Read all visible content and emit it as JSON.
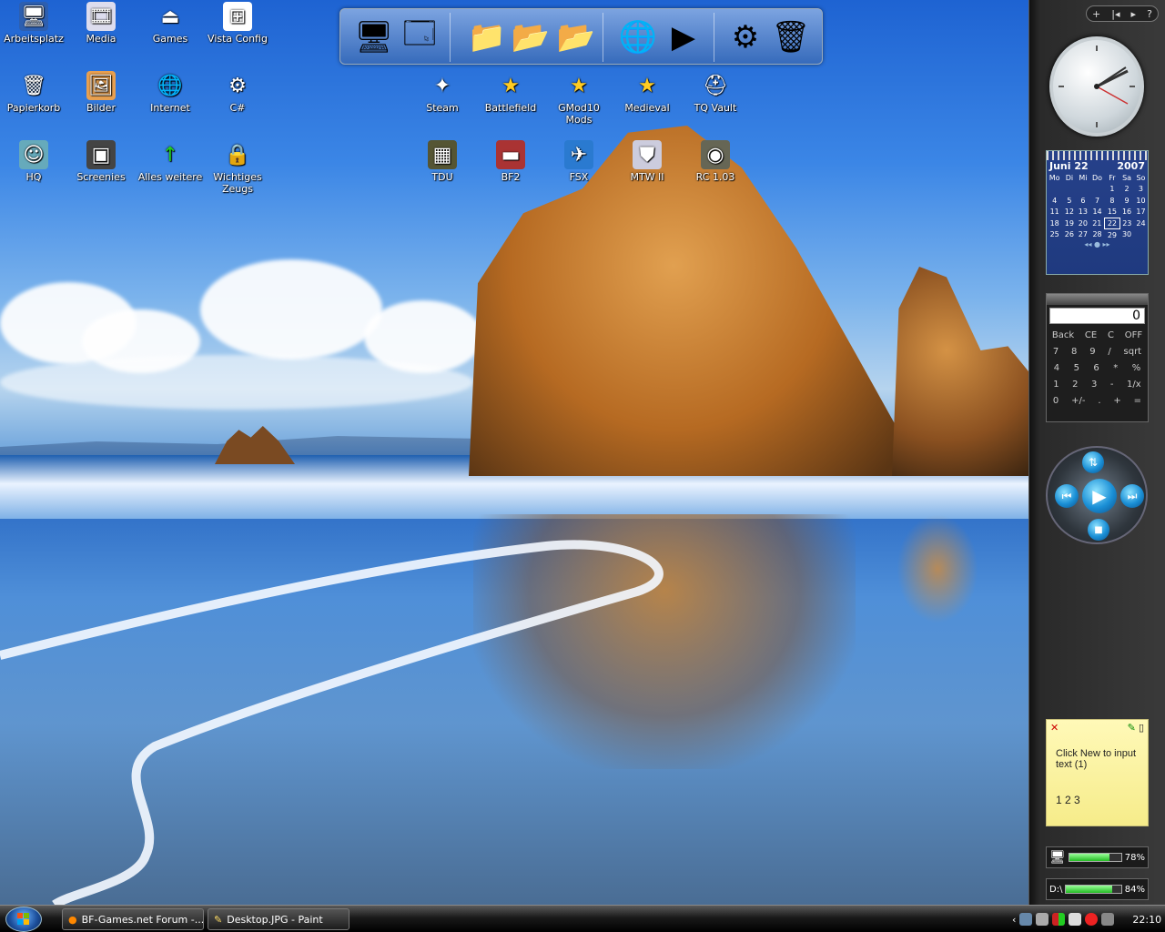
{
  "desktop_icons": [
    {
      "label": "Arbeitsplatz",
      "icon": "computer-icon",
      "glyph": "🖥",
      "bg": "#2d5fb0"
    },
    {
      "label": "Media",
      "icon": "media-file-icon",
      "glyph": "🎞",
      "bg": "#dde"
    },
    {
      "label": "Games",
      "icon": "eject-icon",
      "glyph": "⏏",
      "bg": "transparent"
    },
    {
      "label": "Vista Config",
      "icon": "windows-flag-icon",
      "glyph": "⊞",
      "bg": "#fff"
    },
    {
      "label": "Papierkorb",
      "icon": "recycle-bin-icon",
      "glyph": "🗑",
      "bg": "transparent"
    },
    {
      "label": "Bilder",
      "icon": "pictures-icon",
      "glyph": "🖼",
      "bg": "#e8a050"
    },
    {
      "label": "Internet",
      "icon": "globe-icon",
      "glyph": "🌐",
      "bg": "transparent"
    },
    {
      "label": "C#",
      "icon": "gear-icon",
      "glyph": "⚙",
      "bg": "transparent"
    },
    {
      "label": "HQ",
      "icon": "hq-game-icon",
      "glyph": "☺",
      "bg": "#6ab"
    },
    {
      "label": "Screenies",
      "icon": "monitor-icon",
      "glyph": "▣",
      "bg": "#444"
    },
    {
      "label": "Alles weitere",
      "icon": "green-arrow-icon",
      "glyph": "↑",
      "bg": "transparent"
    },
    {
      "label": "Wichtiges Zeugs",
      "icon": "lock-icon",
      "glyph": "🔒",
      "bg": "transparent"
    },
    {
      "label": "Steam",
      "icon": "steam-icon",
      "glyph": "✦",
      "bg": "transparent"
    },
    {
      "label": "Battlefield",
      "icon": "star-icon",
      "glyph": "★",
      "bg": "transparent"
    },
    {
      "label": "GMod10 Mods",
      "icon": "star-icon",
      "glyph": "★",
      "bg": "transparent"
    },
    {
      "label": "Medieval",
      "icon": "star-icon",
      "glyph": "★",
      "bg": "transparent"
    },
    {
      "label": "TQ Vault",
      "icon": "helmet-icon",
      "glyph": "⛑",
      "bg": "transparent"
    },
    {
      "label": "TDU",
      "icon": "tdu-game-icon",
      "glyph": "▦",
      "bg": "#553"
    },
    {
      "label": "BF2",
      "icon": "bf2-game-icon",
      "glyph": "▬",
      "bg": "#a33"
    },
    {
      "label": "FSX",
      "icon": "airplane-icon",
      "glyph": "✈",
      "bg": "#2a7ad0"
    },
    {
      "label": "MTW II",
      "icon": "mtw-game-icon",
      "glyph": "⛊",
      "bg": "#ccd"
    },
    {
      "label": "RC 1.03",
      "icon": "seal-icon",
      "glyph": "◉",
      "bg": "#665"
    }
  ],
  "dock": {
    "items": [
      {
        "icon": "computer-dock-icon",
        "glyph": "🖥"
      },
      {
        "icon": "control-panel-dock-icon",
        "glyph": "🗔"
      },
      {
        "icon": "folder-dock-icon",
        "glyph": "📁"
      },
      {
        "icon": "documents-folder-dock-icon",
        "glyph": "📂"
      },
      {
        "icon": "music-folder-dock-icon",
        "glyph": "📂"
      },
      {
        "icon": "globe-dock-icon",
        "glyph": "🌐"
      },
      {
        "icon": "media-player-dock-icon",
        "glyph": "▶"
      },
      {
        "icon": "settings-dock-icon",
        "glyph": "⚙"
      },
      {
        "icon": "recycle-bin-dock-icon",
        "glyph": "🗑"
      }
    ]
  },
  "sidebar": {
    "controls": [
      "+",
      "|◂",
      "▸",
      "?"
    ],
    "calendar": {
      "month": "Juni 22",
      "year": "2007",
      "weekdays": [
        "Mo",
        "Di",
        "Mi",
        "Do",
        "Fr",
        "Sa",
        "So"
      ],
      "weeks": [
        [
          "",
          "",
          "",
          "",
          "1",
          "2",
          "3"
        ],
        [
          "4",
          "5",
          "6",
          "7",
          "8",
          "9",
          "10"
        ],
        [
          "11",
          "12",
          "13",
          "14",
          "15",
          "16",
          "17"
        ],
        [
          "18",
          "19",
          "20",
          "21",
          "22",
          "23",
          "24"
        ],
        [
          "25",
          "26",
          "27",
          "28",
          "29",
          "30",
          ""
        ]
      ],
      "today": "22",
      "nav": "◂◂ ● ▸▸"
    },
    "calculator": {
      "display": "0",
      "rows": [
        [
          "Back",
          "CE",
          "C",
          "OFF"
        ],
        [
          "7",
          "8",
          "9",
          "/",
          "sqrt"
        ],
        [
          "4",
          "5",
          "6",
          "*",
          "%"
        ],
        [
          "1",
          "2",
          "3",
          "-",
          "1/x"
        ],
        [
          "0",
          "+/-",
          ".",
          "+",
          "="
        ]
      ]
    },
    "note": {
      "text": "Click New to input text (1)",
      "pages": "1  2  3"
    },
    "cpu_meter": {
      "percent": "78%",
      "value": 0.78
    },
    "disk_meter": {
      "drive": "D:\\",
      "percent": "84%",
      "value": 0.84
    }
  },
  "taskbar": {
    "tasks": [
      {
        "label": "BF-Games.net Forum -...",
        "icon": "firefox-icon"
      },
      {
        "label": "Desktop.JPG - Paint",
        "icon": "paint-icon"
      }
    ],
    "clock": "22:10"
  },
  "colors": {
    "accent": "#1a8fd6",
    "sidebar": "#2a2a2a",
    "note": "#f6ec8a"
  }
}
